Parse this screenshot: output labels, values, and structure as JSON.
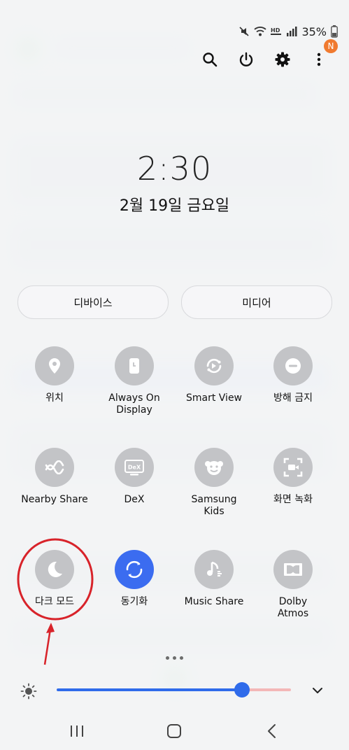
{
  "status_bar": {
    "icons": [
      "mute-icon",
      "wifi-icon",
      "hd-voice-icon",
      "signal-icon"
    ],
    "battery_percent": "35%",
    "battery_icon": "battery-icon"
  },
  "header_actions": {
    "icons": [
      "search-icon",
      "power-icon",
      "gear-icon",
      "more-vert-icon"
    ],
    "notification_badge": "N"
  },
  "clock": {
    "time": "2:30",
    "date": "2월 19일 금요일"
  },
  "panels": {
    "devices": "디바이스",
    "media": "미디어"
  },
  "tiles": [
    {
      "label": "위치",
      "icon": "location-pin-icon",
      "active": false
    },
    {
      "label": "Always On Display",
      "icon": "always-on-display-icon",
      "active": false
    },
    {
      "label": "Smart View",
      "icon": "smart-view-icon",
      "active": false
    },
    {
      "label": "방해 금지",
      "icon": "do-not-disturb-icon",
      "active": false
    },
    {
      "label": "Nearby Share",
      "icon": "nearby-share-icon",
      "active": false
    },
    {
      "label": "DeX",
      "icon": "dex-icon",
      "active": false
    },
    {
      "label": "Samsung Kids",
      "icon": "samsung-kids-icon",
      "active": false
    },
    {
      "label": "화면 녹화",
      "icon": "screen-record-icon",
      "active": false
    },
    {
      "label": "다크 모드",
      "icon": "moon-icon",
      "active": false
    },
    {
      "label": "동기화",
      "icon": "sync-icon",
      "active": true
    },
    {
      "label": "Music Share",
      "icon": "music-share-icon",
      "active": false
    },
    {
      "label": "Dolby Atmos",
      "icon": "dolby-icon",
      "active": false
    }
  ],
  "page_indicator": {
    "pages": 3
  },
  "brightness": {
    "level": 0.79,
    "icon": "brightness-icon",
    "expand_icon": "chevron-down-icon"
  },
  "nav_bar": {
    "icons": [
      "recent-apps-icon",
      "home-icon",
      "back-icon"
    ]
  },
  "colors": {
    "accent": "#3b6cf0",
    "tile_inactive": "#c3c4c7",
    "annotation": "#d8232a",
    "badge": "#f07a2f"
  }
}
